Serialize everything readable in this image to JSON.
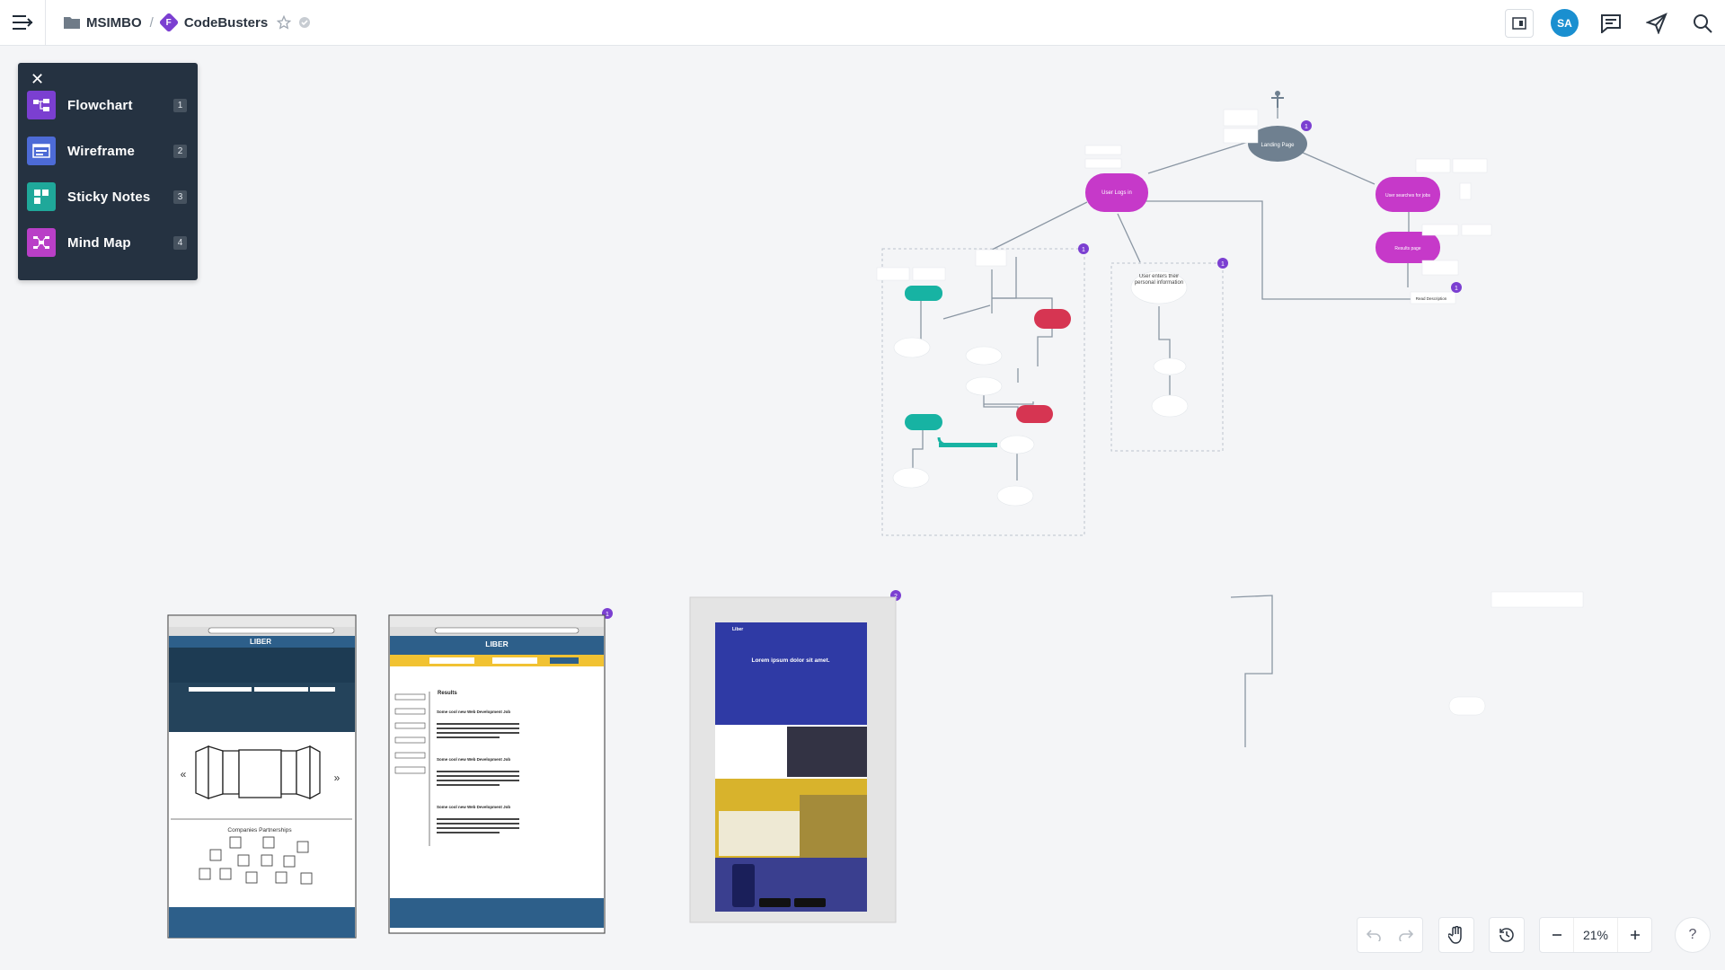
{
  "topbar": {
    "folder_name": "MSIMBO",
    "separator": "/",
    "doc_badge": "F",
    "doc_name": "CodeBusters",
    "avatar_initials": "SA",
    "icons": [
      "menu-icon",
      "folder-icon",
      "star-icon",
      "verified-icon",
      "presentation-icon",
      "comment-icon",
      "share-icon",
      "search-icon"
    ]
  },
  "panel": {
    "items": [
      {
        "label": "Flowchart",
        "key": "1",
        "color": "#7b3fd1"
      },
      {
        "label": "Wireframe",
        "key": "2",
        "color": "#4d6bd6"
      },
      {
        "label": "Sticky Notes",
        "key": "3",
        "color": "#1fa89a"
      },
      {
        "label": "Mind Map",
        "key": "4",
        "color": "#b93fc7"
      }
    ]
  },
  "flow": {
    "landing": "Landing Page",
    "login": "User Logs in",
    "search": "User searches for jobs",
    "results": "Results page",
    "enters_info": "User enters their personal information",
    "read_desc": "Read Description",
    "badges": [
      "1",
      "1",
      "1",
      "1",
      "1",
      "2"
    ]
  },
  "wireframes": {
    "w1_brand": "LIBER",
    "w1_section": "Companies Partnerships",
    "w2_brand": "LIBER",
    "w2_heading": "Results",
    "w2_job": "Some cool new Web Development Job",
    "mock_hero": "Lorem ipsum dolor sit amet.",
    "mock_brand": "Liber"
  },
  "zoom": {
    "value": "21%"
  },
  "colors": {
    "accent": "#7b3fd1",
    "teal": "#17b3a3",
    "magenta": "#c639c9",
    "red": "#d63552",
    "slate": "#6f8090"
  }
}
